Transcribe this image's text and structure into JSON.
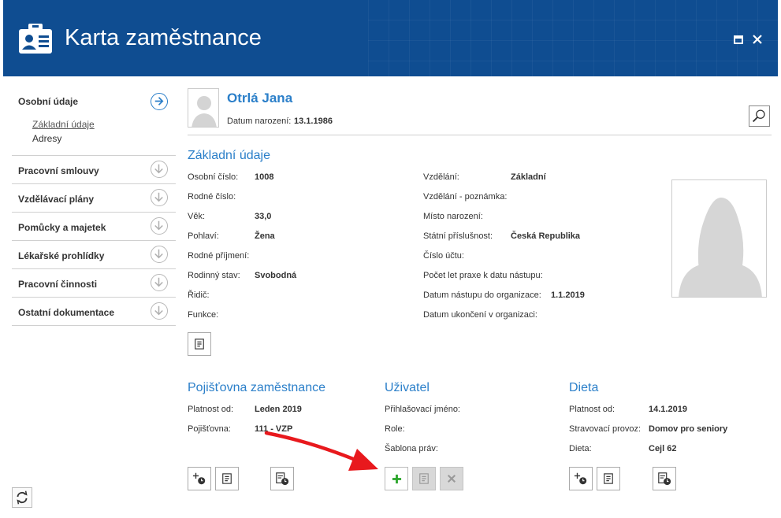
{
  "window": {
    "title": "Karta zaměstnance",
    "maximize_icon": "maximize-icon",
    "close_icon": "close-icon",
    "header_color": "#0f4d91"
  },
  "sidebar": {
    "sections": [
      {
        "title": "Osobní údaje",
        "expanded": true,
        "sub_items": [
          "Základní údaje",
          "Adresy"
        ]
      },
      {
        "title": "Pracovní smlouvy"
      },
      {
        "title": "Vzdělávací plány"
      },
      {
        "title": "Pomůcky a majetek"
      },
      {
        "title": "Lékařské prohlídky"
      },
      {
        "title": "Pracovní činnosti"
      },
      {
        "title": "Ostatní dokumentace"
      }
    ]
  },
  "person": {
    "name": "Otrlá Jana",
    "dob_label": "Datum narození:",
    "dob_value": "13.1.1986"
  },
  "basic": {
    "title": "Základní údaje",
    "left": [
      {
        "label": "Osobní číslo:",
        "value": "1008"
      },
      {
        "label": "Rodné číslo:",
        "value": ""
      },
      {
        "label": "Věk:",
        "value": "33,0"
      },
      {
        "label": "Pohlaví:",
        "value": "Žena"
      },
      {
        "label": "Rodné příjmení:",
        "value": ""
      },
      {
        "label": "Rodinný stav:",
        "value": "Svobodná"
      },
      {
        "label": "Řidič:",
        "value": ""
      },
      {
        "label": "Funkce:",
        "value": ""
      }
    ],
    "right": [
      {
        "label": "Vzdělání:",
        "value": "Základní"
      },
      {
        "label": "Vzdělání - poznámka:",
        "value": ""
      },
      {
        "label": "Místo narození:",
        "value": ""
      },
      {
        "label": "Státní příslušnost:",
        "value": "Česká Republika"
      },
      {
        "label": "Číslo účtu:",
        "value": ""
      },
      {
        "label": "Počet let praxe k datu nástupu:",
        "value": ""
      },
      {
        "label": "Datum nástupu do organizace:",
        "value": "1.1.2019"
      },
      {
        "label": "Datum ukončení v organizaci:",
        "value": ""
      }
    ]
  },
  "insurance": {
    "title": "Pojišťovna zaměstnance",
    "rows": [
      {
        "label": "Platnost od:",
        "value": "Leden 2019"
      },
      {
        "label": "Pojišťovna:",
        "value": "111 - VZP"
      }
    ]
  },
  "user": {
    "title": "Uživatel",
    "rows": [
      {
        "label": "Přihlašovací jméno:",
        "value": ""
      },
      {
        "label": "Role:",
        "value": ""
      },
      {
        "label": "Šablona práv:",
        "value": ""
      }
    ]
  },
  "diet": {
    "title": "Dieta",
    "rows": [
      {
        "label": "Platnost od:",
        "value": "14.1.2019"
      },
      {
        "label": "Stravovací provoz:",
        "value": "Domov pro seniory"
      },
      {
        "label": "Dieta:",
        "value": "Cejl 62"
      }
    ]
  },
  "colors": {
    "accent": "#2b7fc9",
    "annotation_arrow": "#e8191d",
    "add_green": "#2aa52a"
  }
}
